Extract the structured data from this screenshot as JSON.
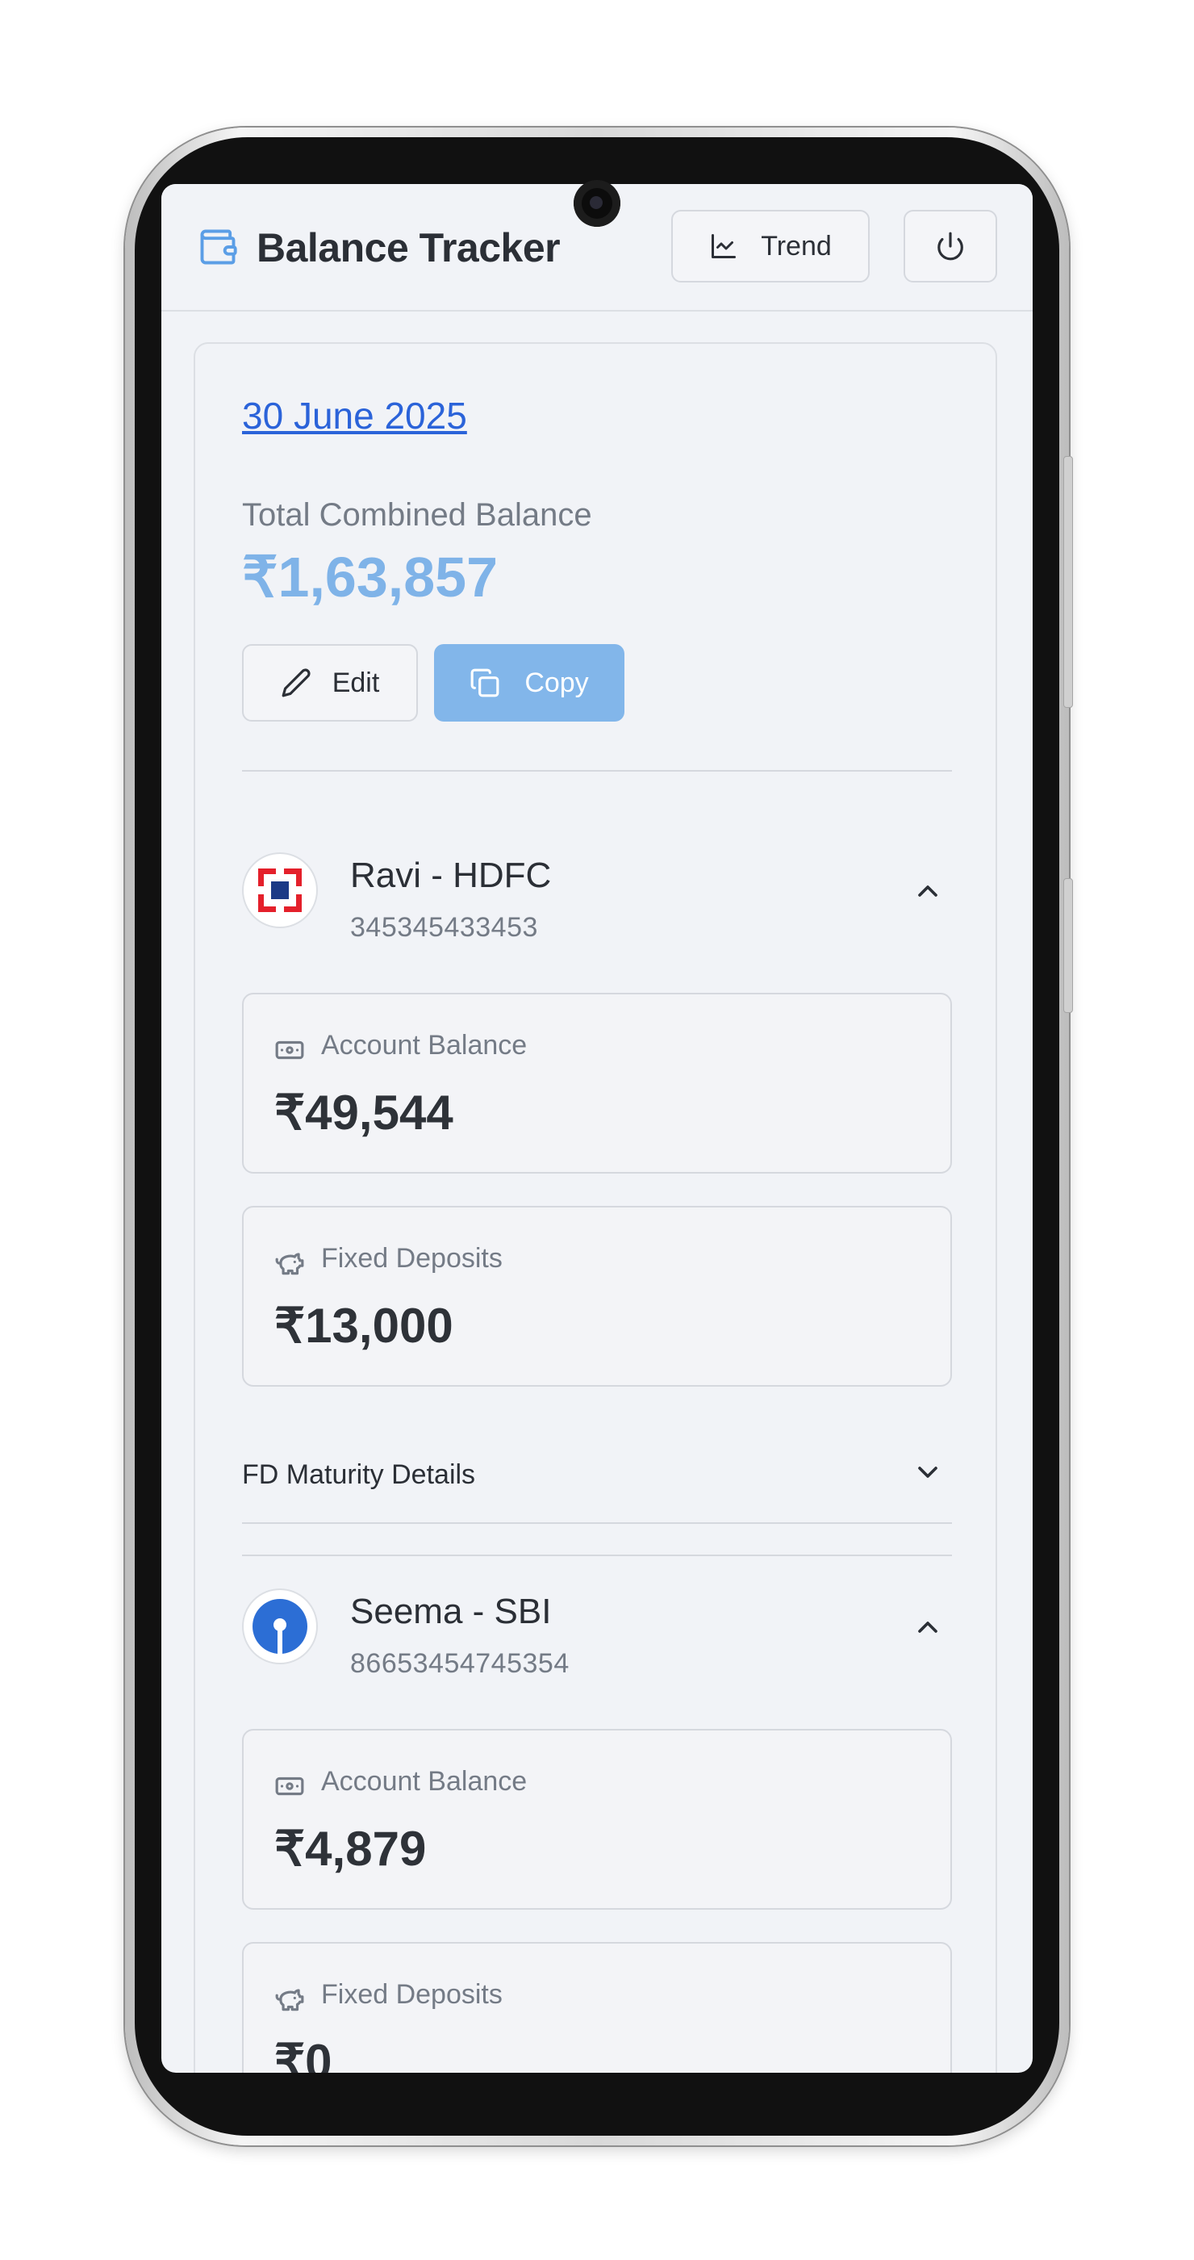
{
  "header": {
    "title": "Balance Tracker",
    "trend_label": "Trend"
  },
  "summary": {
    "date": "30 June 2025",
    "total_label": "Total Combined Balance",
    "total_value": "₹1,63,857",
    "edit_label": "Edit",
    "copy_label": "Copy"
  },
  "accounts": [
    {
      "name": "Ravi - HDFC",
      "number": "345345433453",
      "balance_label": "Account Balance",
      "balance_value": "₹49,544",
      "fd_label": "Fixed Deposits",
      "fd_value": "₹13,000",
      "fd_details_label": "FD Maturity Details"
    },
    {
      "name": "Seema - SBI",
      "number": "86653454745354",
      "balance_label": "Account Balance",
      "balance_value": "₹4,879",
      "fd_label": "Fixed Deposits",
      "fd_value": "₹0"
    }
  ],
  "colors": {
    "accent": "#2b63d9",
    "total": "#7fb3e8",
    "copy_button": "#82b6ea",
    "hdfc_red": "#e4202b",
    "hdfc_blue": "#1b3a86",
    "sbi_blue": "#2c6ed5"
  },
  "icons": {
    "brand": "wallet-icon",
    "trend": "line-chart-icon",
    "power": "power-icon",
    "edit": "pencil-icon",
    "copy": "copy-icon",
    "balance": "banknote-icon",
    "fd": "piggy-bank-icon"
  }
}
